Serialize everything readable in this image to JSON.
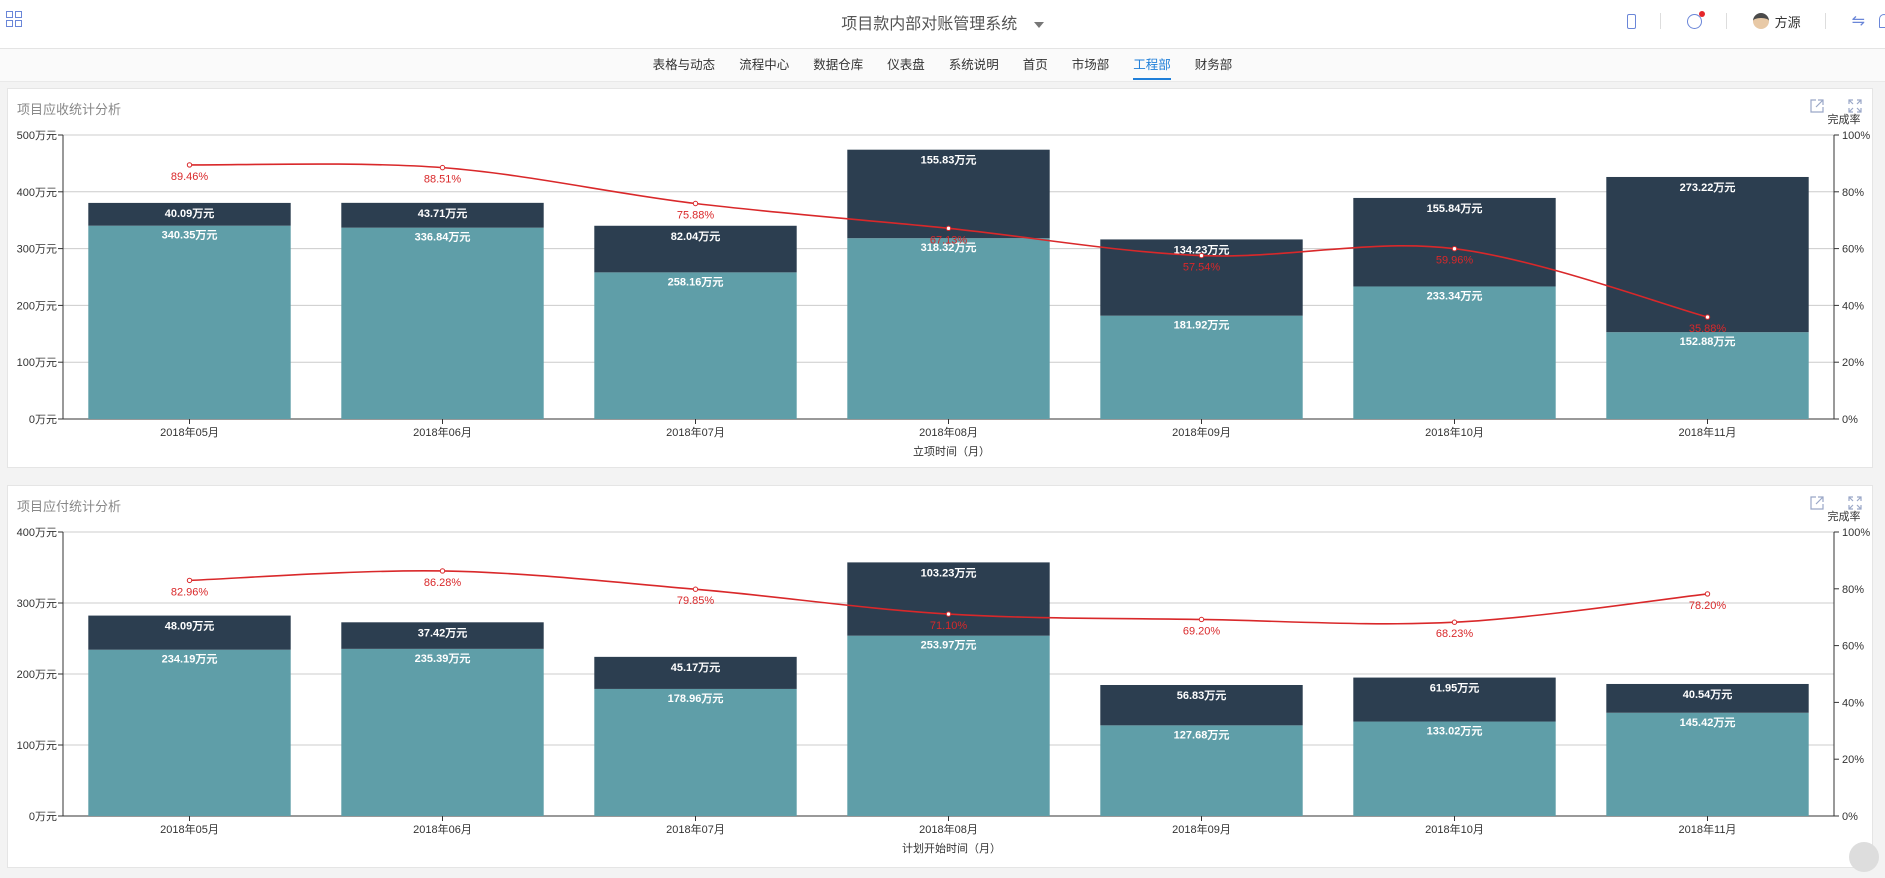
{
  "header": {
    "app_title": "项目款内部对账管理系统",
    "user_name": "方源",
    "icons": [
      "apps-grid-icon",
      "mobile-icon",
      "clock-notification-icon",
      "user-avatar-icon",
      "swap-icon",
      "bell-icon"
    ]
  },
  "nav": {
    "tabs": [
      "表格与动态",
      "流程中心",
      "数据仓库",
      "仪表盘",
      "系统说明",
      "首页",
      "市场部",
      "工程部",
      "财务部"
    ],
    "active": "工程部"
  },
  "colors": {
    "bar_bottom": "#5f9ea8",
    "bar_top": "#2c3e50",
    "line": "#d9282a",
    "accent": "#1f7fd9"
  },
  "chart_data": [
    {
      "type": "bar",
      "title": "项目应收统计分析",
      "xlabel": "立项时间（月）",
      "ylabel_right": "完成率",
      "categories": [
        "2018年05月",
        "2018年06月",
        "2018年07月",
        "2018年08月",
        "2018年09月",
        "2018年10月",
        "2018年11月"
      ],
      "series": [
        {
          "values": [
            340.35,
            336.84,
            258.16,
            318.32,
            181.92,
            233.34,
            152.88
          ],
          "labels": [
            "340.35万元",
            "336.84万元",
            "258.16万元",
            "318.32万元",
            "181.92万元",
            "233.34万元",
            "152.88万元"
          ]
        },
        {
          "values": [
            40.09,
            43.71,
            82.04,
            155.83,
            134.23,
            155.84,
            273.22
          ],
          "labels": [
            "40.09万元",
            "43.71万元",
            "82.04万元",
            "155.83万元",
            "134.23万元",
            "155.84万元",
            "273.22万元"
          ]
        },
        {
          "values": [
            89.46,
            88.51,
            75.88,
            67.13,
            57.54,
            59.96,
            35.88
          ],
          "labels": [
            "89.46%",
            "88.51%",
            "75.88%",
            "67.13%",
            "57.54%",
            "59.96%",
            "35.88%"
          ],
          "axis": "right",
          "kind": "line"
        }
      ],
      "ylim": [
        0,
        500
      ],
      "y_ticks": [
        "0万元",
        "100万元",
        "200万元",
        "300万元",
        "400万元",
        "500万元"
      ],
      "y2lim": [
        0,
        100
      ],
      "y2_ticks": [
        "0%",
        "20%",
        "40%",
        "60%",
        "80%",
        "100%"
      ],
      "grid": true
    },
    {
      "type": "bar",
      "title": "项目应付统计分析",
      "xlabel": "计划开始时间（月）",
      "ylabel_right": "完成率",
      "categories": [
        "2018年05月",
        "2018年06月",
        "2018年07月",
        "2018年08月",
        "2018年09月",
        "2018年10月",
        "2018年11月"
      ],
      "series": [
        {
          "values": [
            234.19,
            235.39,
            178.96,
            253.97,
            127.68,
            133.02,
            145.42
          ],
          "labels": [
            "234.19万元",
            "235.39万元",
            "178.96万元",
            "253.97万元",
            "127.68万元",
            "133.02万元",
            "145.42万元"
          ]
        },
        {
          "values": [
            48.09,
            37.42,
            45.17,
            103.23,
            56.83,
            61.95,
            40.54
          ],
          "labels": [
            "48.09万元",
            "37.42万元",
            "45.17万元",
            "103.23万元",
            "56.83万元",
            "61.95万元",
            "40.54万元"
          ]
        },
        {
          "values": [
            82.96,
            86.28,
            79.85,
            71.1,
            69.2,
            68.23,
            78.2
          ],
          "labels": [
            "82.96%",
            "86.28%",
            "79.85%",
            "71.10%",
            "69.20%",
            "68.23%",
            "78.20%"
          ],
          "axis": "right",
          "kind": "line"
        }
      ],
      "ylim": [
        0,
        400
      ],
      "y_ticks": [
        "0万元",
        "100万元",
        "200万元",
        "300万元",
        "400万元"
      ],
      "y2lim": [
        0,
        100
      ],
      "y2_ticks": [
        "0%",
        "20%",
        "40%",
        "60%",
        "80%",
        "100%"
      ],
      "grid": true
    }
  ]
}
